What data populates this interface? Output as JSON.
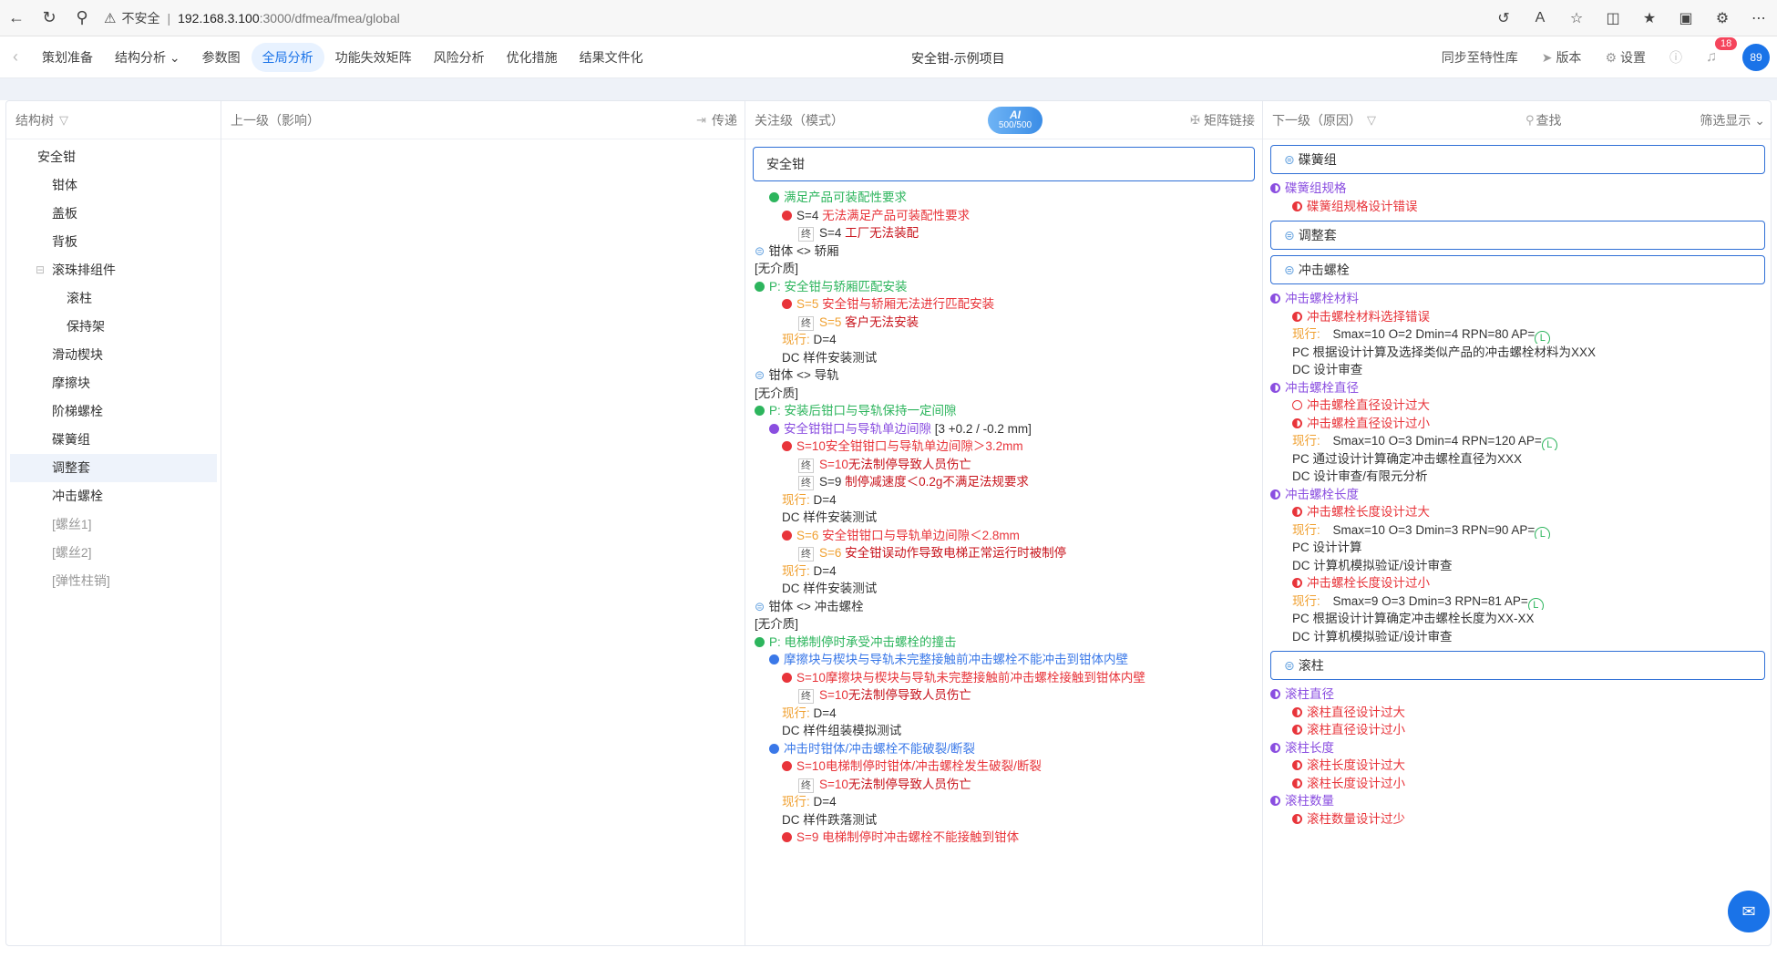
{
  "browser": {
    "insecure": "不安全",
    "host": "192.168.3.100",
    "path": ":3000/dfmea/fmea/global"
  },
  "nav": {
    "items": [
      "策划准备",
      "结构分析",
      "参数图",
      "全局分析",
      "功能失效矩阵",
      "风险分析",
      "优化措施",
      "结果文件化"
    ],
    "title": "安全钳-示例项目",
    "sync": "同步至特性库",
    "version": "版本",
    "settings": "设置",
    "badge": "18",
    "avatar": "89"
  },
  "cols": {
    "tree": "结构树",
    "up": "上一级（影响）",
    "transfer": "传递",
    "focus": "关注级（模式）",
    "ai_label": "AI",
    "ai_count": "500/500",
    "matrix": "矩阵链接",
    "down": "下一级（原因）",
    "search": "查找",
    "filter": "筛选显示"
  },
  "tree": [
    [
      "安全钳",
      0,
      ""
    ],
    [
      "钳体",
      1,
      ""
    ],
    [
      "盖板",
      1,
      ""
    ],
    [
      "背板",
      1,
      ""
    ],
    [
      "滚珠排组件",
      1,
      ""
    ],
    [
      "滚柱",
      2,
      ""
    ],
    [
      "保持架",
      2,
      ""
    ],
    [
      "滑动楔块",
      1,
      ""
    ],
    [
      "摩擦块",
      1,
      ""
    ],
    [
      "阶梯螺栓",
      1,
      ""
    ],
    [
      "碟簧组",
      1,
      ""
    ],
    [
      "调整套",
      1,
      "sel"
    ],
    [
      "冲击螺栓",
      1,
      ""
    ],
    [
      "[螺丝1]",
      1,
      "dim"
    ],
    [
      "[螺丝2]",
      1,
      "dim"
    ],
    [
      "[弹性柱销]",
      1,
      "dim"
    ]
  ],
  "focus_box": "安全钳",
  "focus_lines": [
    [
      "1",
      "g",
      "tg",
      "",
      "满足产品可装配性要求"
    ],
    [
      "2",
      "r",
      "tk",
      "",
      "S=4  ",
      "tr",
      "无法满足产品可装配性要求"
    ],
    [
      "3",
      "end",
      "tk",
      "",
      "S=4  ",
      "tdr",
      "工厂无法装配"
    ],
    [
      "0",
      "link",
      "tk",
      "",
      "钳体 <> 轿厢"
    ],
    [
      "0",
      "",
      "tk",
      "",
      "[无介质]"
    ],
    [
      "0",
      "g",
      "tg",
      "",
      "P: 安全钳与轿厢匹配安装"
    ],
    [
      "2",
      "r",
      "to",
      "",
      "S=5  ",
      "tr",
      "安全钳与轿厢无法进行匹配安装"
    ],
    [
      "3",
      "end",
      "to",
      "",
      "S=5  ",
      "tdr",
      "客户无法安装"
    ],
    [
      "2",
      "",
      "to",
      "",
      "现行:  ",
      "tk",
      "D=4"
    ],
    [
      "2",
      "",
      "tk",
      "",
      "DC  样件安装测试"
    ],
    [
      "0",
      "link",
      "tk",
      "",
      "钳体 <> 导轨"
    ],
    [
      "0",
      "",
      "tk",
      "",
      "[无介质]"
    ],
    [
      "0",
      "g",
      "tg",
      "",
      "P: 安装后钳口与导轨保持一定间隙"
    ],
    [
      "1",
      "p",
      "tp",
      "",
      "安全钳钳口与导轨单边间隙",
      "tk",
      " [3 +0.2 / -0.2 mm]"
    ],
    [
      "2",
      "r",
      "tr",
      "",
      "S=10安全钳钳口与导轨单边间隙＞3.2mm"
    ],
    [
      "3",
      "end",
      "tr",
      "",
      "S=10",
      "tdr",
      "无法制停导致人员伤亡"
    ],
    [
      "3",
      "end",
      "tk",
      "",
      "S=9  ",
      "tdr",
      "制停减速度＜0.2g不满足法规要求"
    ],
    [
      "2",
      "",
      "to",
      "",
      "现行:  ",
      "tk",
      "D=4"
    ],
    [
      "2",
      "",
      "tk",
      "",
      "DC  样件安装测试"
    ],
    [
      "2",
      "r",
      "to",
      "",
      "S=6  ",
      "tr",
      "安全钳钳口与导轨单边间隙＜2.8mm"
    ],
    [
      "3",
      "end",
      "to",
      "",
      "S=6  ",
      "tdr",
      "安全钳误动作导致电梯正常运行时被制停"
    ],
    [
      "2",
      "",
      "to",
      "",
      "现行:  ",
      "tk",
      "D=4"
    ],
    [
      "2",
      "",
      "tk",
      "",
      "DC  样件安装测试"
    ],
    [
      "0",
      "link",
      "tk",
      "",
      "钳体 <> 冲击螺栓"
    ],
    [
      "0",
      "",
      "tk",
      "",
      "[无介质]"
    ],
    [
      "0",
      "g",
      "tg",
      "",
      "P: 电梯制停时承受冲击螺栓的撞击"
    ],
    [
      "1",
      "b",
      "tb",
      "",
      "摩擦块与楔块与导轨未完整接触前冲击螺栓不能冲击到钳体内壁"
    ],
    [
      "2",
      "r",
      "tr",
      "",
      "S=10摩擦块与楔块与导轨未完整接触前冲击螺栓接触到钳体内壁"
    ],
    [
      "3",
      "end",
      "tr",
      "",
      "S=10",
      "tdr",
      "无法制停导致人员伤亡"
    ],
    [
      "2",
      "",
      "to",
      "",
      "现行:  ",
      "tk",
      "D=4"
    ],
    [
      "2",
      "",
      "tk",
      "",
      "DC  样件组装模拟测试"
    ],
    [
      "1",
      "b",
      "tb",
      "",
      "冲击时钳体/冲击螺栓不能破裂/断裂"
    ],
    [
      "2",
      "r",
      "tr",
      "",
      "S=10电梯制停时钳体/冲击螺栓发生破裂/断裂"
    ],
    [
      "3",
      "end",
      "tr",
      "",
      "S=10",
      "tdr",
      "无法制停导致人员伤亡"
    ],
    [
      "2",
      "",
      "to",
      "",
      "现行:  ",
      "tk",
      "D=4"
    ],
    [
      "2",
      "",
      "tk",
      "",
      "DC  样件跌落测试"
    ],
    [
      "2",
      "r",
      "tr",
      "",
      "S=9  电梯制停时冲击螺栓不能接触到钳体"
    ]
  ],
  "down": [
    [
      "box",
      "碟簧组"
    ],
    [
      "0",
      "half",
      "tp",
      "碟簧组规格"
    ],
    [
      "1",
      "halfr",
      "tr",
      "碟簧组规格设计错误"
    ],
    [
      "box",
      "调整套"
    ],
    [
      "box",
      "冲击螺栓"
    ],
    [
      "0",
      "half",
      "tp",
      "冲击螺栓材料"
    ],
    [
      "1",
      "halfr",
      "tr",
      "冲击螺栓材料选择错误"
    ],
    [
      "1",
      "cur",
      "",
      "Smax=10 O=2 Dmin=4 RPN=80 AP="
    ],
    [
      "1",
      "",
      "tk",
      "PC  根据设计计算及选择类似产品的冲击螺栓材料为XXX"
    ],
    [
      "1",
      "",
      "tk",
      "DC  设计审查"
    ],
    [
      "0",
      "half",
      "tp",
      "冲击螺栓直径"
    ],
    [
      "1",
      "ring",
      "tr",
      "冲击螺栓直径设计过大"
    ],
    [
      "1",
      "halfr",
      "tr",
      "冲击螺栓直径设计过小"
    ],
    [
      "1",
      "cur",
      "",
      "Smax=10 O=3 Dmin=4 RPN=120 AP="
    ],
    [
      "1",
      "",
      "tk",
      "PC  通过设计计算确定冲击螺栓直径为XXX"
    ],
    [
      "1",
      "",
      "tk",
      "DC  设计审查/有限元分析"
    ],
    [
      "0",
      "half",
      "tp",
      "冲击螺栓长度"
    ],
    [
      "1",
      "halfr",
      "tr",
      "冲击螺栓长度设计过大"
    ],
    [
      "1",
      "cur",
      "",
      "Smax=10 O=3 Dmin=3 RPN=90 AP="
    ],
    [
      "1",
      "",
      "tk",
      "PC  设计计算"
    ],
    [
      "1",
      "",
      "tk",
      "DC  计算机模拟验证/设计审查"
    ],
    [
      "1",
      "halfr",
      "tr",
      "冲击螺栓长度设计过小"
    ],
    [
      "1",
      "cur",
      "",
      "Smax=9 O=3 Dmin=3 RPN=81 AP="
    ],
    [
      "1",
      "",
      "tk",
      "PC  根据设计计算确定冲击螺栓长度为XX-XX"
    ],
    [
      "1",
      "",
      "tk",
      "DC  计算机模拟验证/设计审查"
    ],
    [
      "box",
      "滚柱"
    ],
    [
      "0",
      "half",
      "tp",
      "滚柱直径"
    ],
    [
      "1",
      "halfr",
      "tr",
      "滚柱直径设计过大"
    ],
    [
      "1",
      "halfr",
      "tr",
      "滚柱直径设计过小"
    ],
    [
      "0",
      "half",
      "tp",
      "滚柱长度"
    ],
    [
      "1",
      "halfr",
      "tr",
      "滚柱长度设计过大"
    ],
    [
      "1",
      "halfr",
      "tr",
      "滚柱长度设计过小"
    ],
    [
      "0",
      "half",
      "tp",
      "滚柱数量"
    ],
    [
      "1",
      "halfr",
      "tr",
      "滚柱数量设计过少"
    ]
  ],
  "cur_label": "现行:",
  "ap": "L"
}
